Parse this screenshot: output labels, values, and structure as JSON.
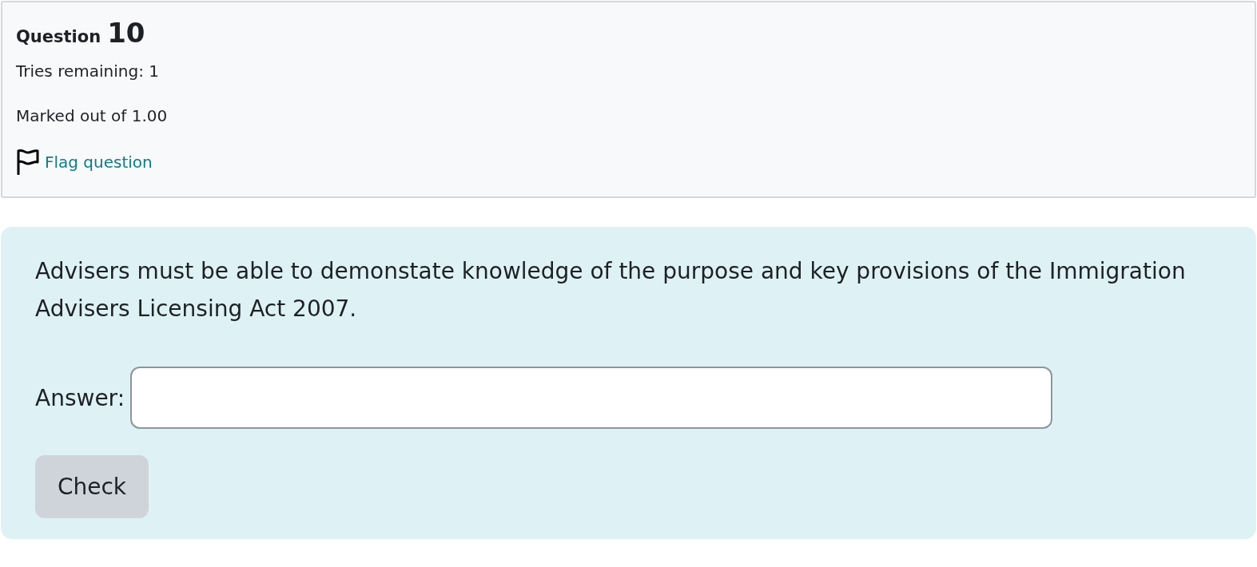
{
  "info": {
    "heading_label": "Question",
    "heading_number": "10",
    "lines": [
      "Tries remaining: 1",
      "Marked out of 1.00"
    ],
    "flag": {
      "label": "Flag question",
      "flagged": false
    }
  },
  "question": {
    "text": "Advisers must be able to demonstate knowledge of the purpose and key provisions of the Immigration Advisers Licensing Act 2007.",
    "answer_label": "Answer:",
    "button": "Check"
  }
}
